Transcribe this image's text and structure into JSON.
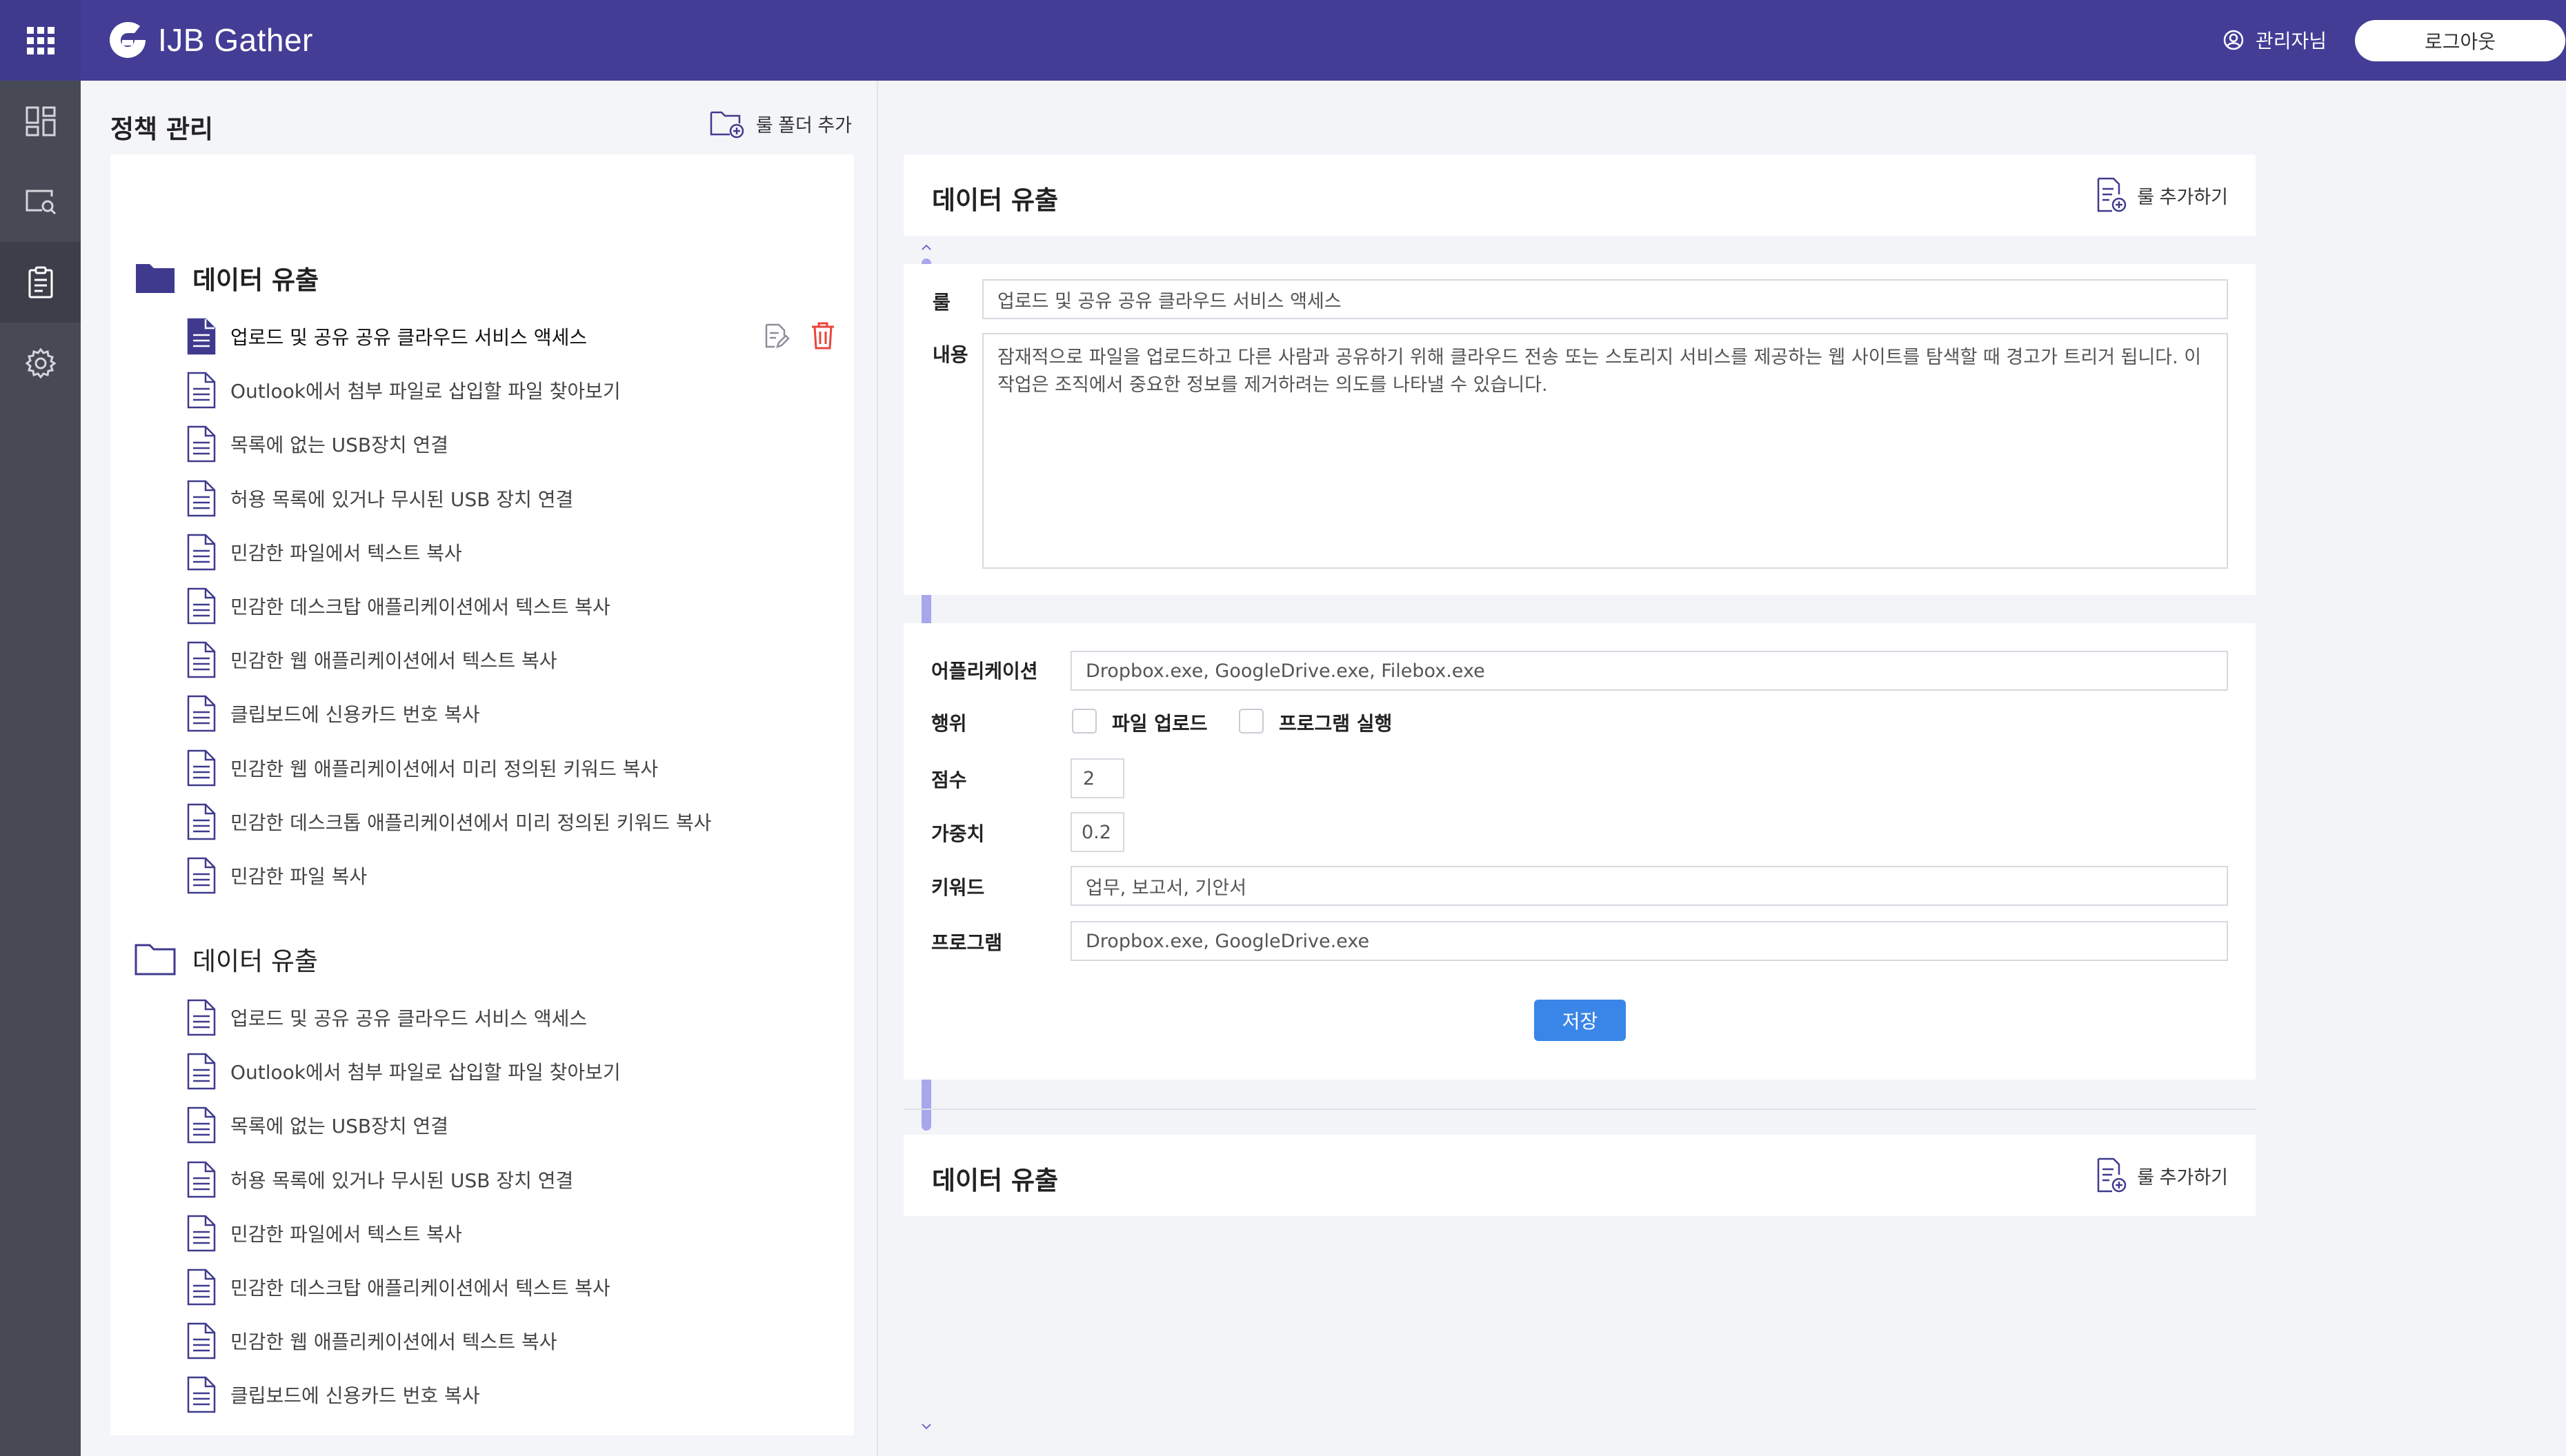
{
  "header": {
    "logo_text": "IJB Gather",
    "user_label": "관리자님",
    "logout_label": "로그아웃"
  },
  "sidebar_icons": [
    "apps-grid-icon",
    "dashboard-icon",
    "monitor-search-icon",
    "clipboard-icon",
    "gear-icon"
  ],
  "left_panel": {
    "title": "정책 관리",
    "add_folder_label": "룰 폴더 추가",
    "folders": [
      {
        "name": "데이터 유출",
        "open": true,
        "rules": [
          "업로드 및 공유 공유 클라우드 서비스 액세스",
          "Outlook에서 첨부 파일로 삽입할 파일 찾아보기",
          "목록에 없는 USB장치 연결",
          "허용 목록에 있거나 무시된 USB 장치 연결",
          "민감한 파일에서 텍스트 복사",
          "민감한 데스크탑 애플리케이션에서 텍스트 복사",
          "민감한 웹 애플리케이션에서 텍스트 복사",
          "클립보드에 신용카드 번호 복사",
          "민감한 웹 애플리케이션에서 미리 정의된 키워드 복사",
          "민감한 데스크톱 애플리케이션에서 미리 정의된 키워드 복사",
          "민감한 파일 복사"
        ]
      },
      {
        "name": "데이터 유출",
        "open": false,
        "rules": [
          "업로드 및 공유 공유 클라우드 서비스 액세스",
          "Outlook에서 첨부 파일로 삽입할 파일 찾아보기",
          "목록에 없는 USB장치 연결",
          "허용 목록에 있거나 무시된 USB 장치 연결",
          "민감한 파일에서 텍스트 복사",
          "민감한 데스크탑 애플리케이션에서 텍스트 복사",
          "민감한 웹 애플리케이션에서 텍스트 복사",
          "클립보드에 신용카드 번호 복사"
        ]
      }
    ],
    "scroll_thumb_fraction": 0.755
  },
  "detail": {
    "section_title": "데이터 유출",
    "add_rule_label": "룰 추가하기",
    "rule_label": "룰",
    "rule_value": "업로드 및 공유 공유 클라우드 서비스 액세스",
    "content_label": "내용",
    "content_value": "잠재적으로 파일을 업로드하고 다른 사람과 공유하기 위해 클라우드 전송 또는 스토리지 서비스를 제공하는 웹 사이트를 탐색할 때 경고가 트리거 됩니다. 이 작업은 조직에서 중요한 정보를 제거하려는 의도를 나타낼 수 있습니다.",
    "app_label": "어플리케이션",
    "app_value": "Dropbox.exe, GoogleDrive.exe, Filebox.exe",
    "action_label": "행위",
    "action_options": [
      {
        "label": "파일 업로드",
        "checked": false
      },
      {
        "label": "프로그램 실행",
        "checked": false
      }
    ],
    "score_label": "점수",
    "score_value": "2",
    "weight_label": "가중치",
    "weight_value": "0.2",
    "keyword_label": "키워드",
    "keyword_value": "업무, 보고서, 기안서",
    "program_label": "프로그램",
    "program_value": "Dropbox.exe, GoogleDrive.exe",
    "save_label": "저장"
  },
  "second_section": {
    "title": "데이터 유출",
    "add_rule_label": "룰 추가하기"
  },
  "colors": {
    "header": "#443d96",
    "rail": "#474a55",
    "accent": "#3a86e8",
    "folder": "#3f3a8e",
    "delete": "#e8453c",
    "scroll_thumb": "#a8a6ec"
  }
}
